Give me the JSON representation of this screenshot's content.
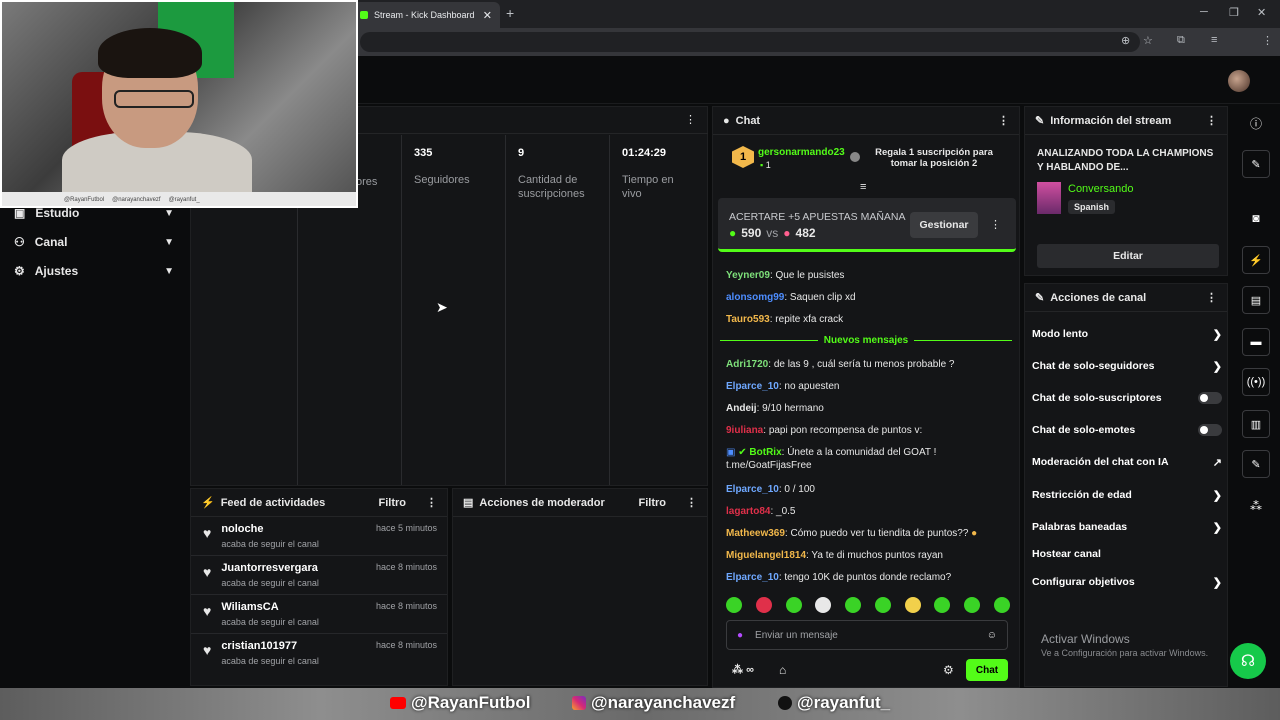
{
  "browser": {
    "tab_title": "Stream - Kick Dashboard",
    "tab_close": "✕",
    "new_tab": "+",
    "window_controls": [
      "─",
      "❐",
      "✕"
    ],
    "toolbar_icons": [
      "⊕",
      "☆",
      "⧉",
      "≡",
      "⋮"
    ]
  },
  "webcam": {
    "social_handles": [
      "@RayanFutbol",
      "@narayanchavezf",
      "@rayanfut_"
    ]
  },
  "nav": {
    "items": [
      {
        "label": "Estudio",
        "icon": "video-icon"
      },
      {
        "label": "Canal",
        "icon": "people-icon"
      },
      {
        "label": "Ajustes",
        "icon": "gear-icon"
      }
    ]
  },
  "stats": {
    "columns": [
      {
        "value": "",
        "label": "ores"
      },
      {
        "value": "335",
        "label": "Seguidores"
      },
      {
        "value": "9",
        "label": "Cantidad de suscripciones"
      },
      {
        "value": "01:24:29",
        "label": "Tiempo en vivo"
      }
    ]
  },
  "feed": {
    "title": "Feed de actividades",
    "filter": "Filtro",
    "items": [
      {
        "user": "noloche",
        "action": "acaba de seguir el canal",
        "time": "hace 5 minutos"
      },
      {
        "user": "Juantorresvergara",
        "action": "acaba de seguir el canal",
        "time": "hace 8 minutos"
      },
      {
        "user": "WiliamsCA",
        "action": "acaba de seguir el canal",
        "time": "hace 8 minutos"
      },
      {
        "user": "cristian101977",
        "action": "acaba de seguir el canal",
        "time": "hace 8 minutos"
      }
    ]
  },
  "modactions": {
    "title": "Acciones de moderador",
    "filter": "Filtro"
  },
  "chat": {
    "title": "Chat",
    "gifter": {
      "rank": "1",
      "user": "gersonarmando23",
      "count": "1",
      "text": "Regala 1 suscripción para tomar la posición 2"
    },
    "prediction": {
      "title": "ACERTARE +5 APUESTAS MAÑANA",
      "left": "590",
      "vs": "vs",
      "right": "482",
      "manage": "Gestionar"
    },
    "messages_before": [
      {
        "user": "Yeyner09",
        "text": "Que le pusistes",
        "color": "#7ee07a"
      },
      {
        "user": "alonsomg99",
        "text": "Saquen clip xd",
        "color": "#4d8dff"
      },
      {
        "user": "Tauro593",
        "text": "repite xfa crack",
        "color": "#f2b84b"
      }
    ],
    "new_messages_label": "Nuevos mensajes",
    "messages_after": [
      {
        "user": "Adri1720",
        "text": "de las 9 , cuál sería tu menos probable ?",
        "color": "#7ee07a"
      },
      {
        "user": "Elparce_10",
        "text": "no apuesten",
        "color": "#6fa8ff"
      },
      {
        "user": "Andeij",
        "text": "9/10 hermano",
        "color": "#e8e8e8"
      },
      {
        "user": "9iuliana",
        "text": "papi pon recompensa de puntos v:",
        "color": "#e0304a"
      },
      {
        "user": "BotRix",
        "text": "Únete a la comunidad del GOAT ! t.me/GoatFijasFree",
        "color": "#53fc18"
      },
      {
        "user": "Elparce_10",
        "text": "0 / 100",
        "color": "#6fa8ff"
      },
      {
        "user": "lagarto84",
        "text": "_0.5",
        "color": "#e0304a"
      },
      {
        "user": "Matheew369",
        "text": "Cómo puedo ver tu tiendita de puntos??",
        "color": "#f2b84b"
      },
      {
        "user": "Miguelangel1814",
        "text": "Ya te di muchos puntos rayan",
        "color": "#f2b84b"
      },
      {
        "user": "Elparce_10",
        "text": "tengo 10K de puntos donde reclamo?",
        "color": "#6fa8ff"
      }
    ],
    "input_placeholder": "Enviar un mensaje",
    "send_label": "Chat",
    "points_symbol": "∞"
  },
  "info": {
    "title": "Información del stream",
    "stream_title": "ANALIZANDO TODA LA CHAMPIONS Y HABLANDO DE...",
    "category": "Conversando",
    "language": "Spanish",
    "edit": "Editar"
  },
  "channel_actions": {
    "title": "Acciones de canal",
    "items": [
      {
        "label": "Modo lento",
        "kind": "chevron"
      },
      {
        "label": "Chat de solo-seguidores",
        "kind": "chevron"
      },
      {
        "label": "Chat de solo-suscriptores",
        "kind": "toggle"
      },
      {
        "label": "Chat de solo-emotes",
        "kind": "toggle"
      },
      {
        "label": "Moderación del chat con IA",
        "kind": "external"
      },
      {
        "label": "Restricción de edad",
        "kind": "chevron"
      },
      {
        "label": "Palabras baneadas",
        "kind": "chevron"
      },
      {
        "label": "Hostear canal",
        "kind": "none"
      },
      {
        "label": "Configurar objetivos",
        "kind": "chevron"
      }
    ]
  },
  "watermark": {
    "line1": "Activar Windows",
    "line2": "Ve a Configuración para activar Windows."
  },
  "footer": {
    "youtube": "@RayanFutbol",
    "instagram": "@narayanchavezf",
    "tiktok": "@rayanfut_"
  },
  "colors": {
    "accent": "#53fc18",
    "panel": "#141517",
    "background": "#0b0c0d"
  }
}
